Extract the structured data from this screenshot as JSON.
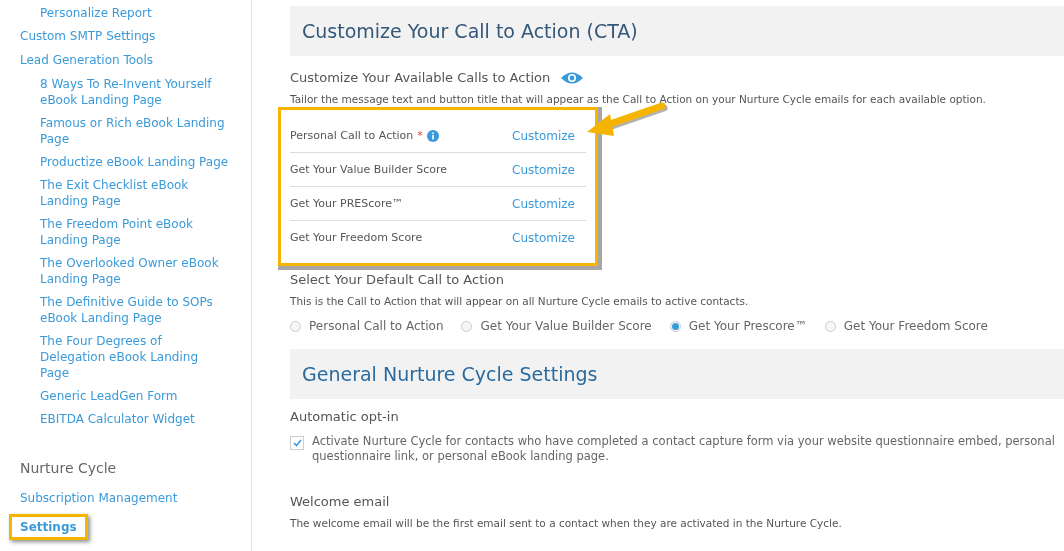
{
  "sidebar": {
    "items": [
      {
        "children": [
          {
            "label": "Personalize Report",
            "selected": false
          }
        ]
      },
      {
        "label": "Custom SMTP Settings",
        "selected": false
      },
      {
        "label": "Lead Generation Tools",
        "selected": false,
        "children": [
          {
            "label": "8 Ways To Re-Invent Yourself eBook Landing Page",
            "selected": false
          },
          {
            "label": "Famous or Rich eBook Landing Page",
            "selected": false
          },
          {
            "label": "Productize eBook Landing Page",
            "selected": false
          },
          {
            "label": "The Exit Checklist eBook Landing Page",
            "selected": false
          },
          {
            "label": "The Freedom Point eBook Landing Page",
            "selected": false
          },
          {
            "label": "The Overlooked Owner eBook Landing Page",
            "selected": false
          },
          {
            "label": "The Definitive Guide to SOPs eBook Landing Page",
            "selected": false
          },
          {
            "label": "The Four Degrees of Delegation eBook Landing Page",
            "selected": false
          },
          {
            "label": "Generic LeadGen Form",
            "selected": false
          },
          {
            "label": "EBITDA Calculator Widget",
            "selected": false
          }
        ]
      }
    ],
    "section": {
      "heading": "Nurture Cycle",
      "items": [
        {
          "label": "Subscription Management",
          "selected": false,
          "highlighted": false
        },
        {
          "label": "Settings",
          "selected": true,
          "highlighted": true
        }
      ]
    }
  },
  "cta_section": {
    "title": "Customize Your Call to Action (CTA)",
    "subheading": "Customize Your Available Calls to Action",
    "description": "Tailor the message text and button title that will appear as the Call to Action on your Nurture Cycle emails for each available option.",
    "highlighted": true,
    "pointer_arrow": true,
    "rows": [
      {
        "label": "Personal Call to Action",
        "marker": "*",
        "info": true,
        "action": "Customize"
      },
      {
        "label": "Get Your Value Builder Score",
        "action": "Customize"
      },
      {
        "label": "Get Your PREScore™",
        "action": "Customize"
      },
      {
        "label": "Get Your Freedom Score",
        "action": "Customize"
      }
    ],
    "default": {
      "heading": "Select Your Default Call to Action",
      "description": "This is the Call to Action that will appear on all Nurture Cycle emails to active contacts.",
      "options": [
        {
          "label": "Personal Call to Action",
          "selected": false
        },
        {
          "label": "Get Your Value Builder Score",
          "selected": false
        },
        {
          "label": "Get Your Prescore™",
          "selected": true
        },
        {
          "label": "Get Your Freedom Score",
          "selected": false
        }
      ]
    }
  },
  "general_section": {
    "title": "General Nurture Cycle Settings",
    "opt_in": {
      "heading": "Automatic opt-in",
      "label": "Activate Nurture Cycle for contacts who have completed a contact capture form via your website questionnaire embed, personal questionnaire link, or personal eBook landing page.",
      "checked": true
    },
    "welcome": {
      "heading": "Welcome email",
      "description": "The welcome email will be the first email sent to a contact when they are activated in the Nurture Cycle."
    }
  }
}
